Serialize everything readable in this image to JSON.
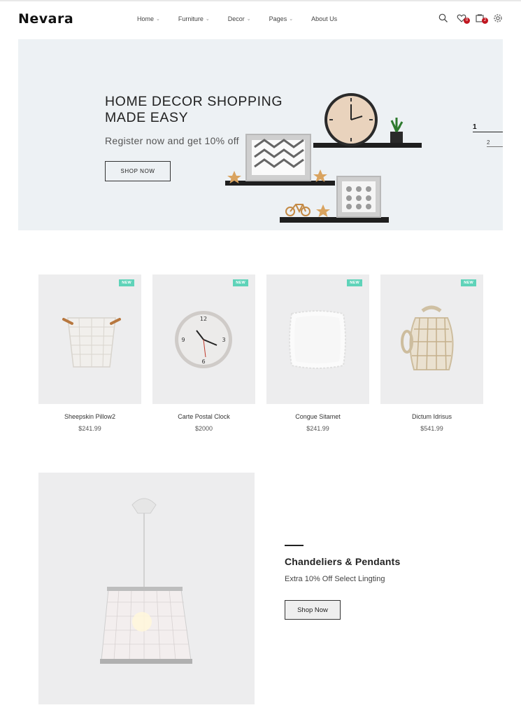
{
  "brand": {
    "logo": "Nevara"
  },
  "nav": {
    "items": [
      {
        "label": "Home",
        "has_dropdown": true
      },
      {
        "label": "Furniture",
        "has_dropdown": true
      },
      {
        "label": "Decor",
        "has_dropdown": true
      },
      {
        "label": "Pages",
        "has_dropdown": true
      },
      {
        "label": "About Us",
        "has_dropdown": false
      }
    ],
    "caret": "⌄"
  },
  "header_icons": {
    "search": {
      "icon": "search-icon"
    },
    "wishlist": {
      "icon": "heart-icon",
      "count": "0"
    },
    "cart": {
      "icon": "cart-icon",
      "count": "2"
    },
    "settings": {
      "icon": "gear-icon"
    }
  },
  "hero": {
    "title": "HOME DECOR SHOPPING\nMADE EASY",
    "subtitle": "Register now and get 10% off",
    "button_label": "SHOP NOW",
    "slides": [
      "1",
      "2"
    ],
    "active_slide": "1",
    "background": "#edf1f4"
  },
  "products": [
    {
      "name": "Sheepskin Pillow2",
      "price": "$241.99",
      "badge": "NEW",
      "image": "wicker-basket"
    },
    {
      "name": "Carte Postal Clock",
      "price": "$2000",
      "badge": "NEW",
      "image": "wall-clock"
    },
    {
      "name": "Congue Sitamet",
      "price": "$241.99",
      "badge": "NEW",
      "image": "white-pillow"
    },
    {
      "name": "Dictum Idrisus",
      "price": "$541.99",
      "badge": "NEW",
      "image": "rope-lantern"
    }
  ],
  "feature": {
    "title": "Chandeliers & Pendants",
    "subtitle": "Extra 10% Off Select Lingting",
    "button_label": "Shop Now",
    "image": "pendant-lamp"
  },
  "colors": {
    "badge_new": "#5fd3b9",
    "count_badge": "#c0151f",
    "card_bg": "#ededee"
  }
}
